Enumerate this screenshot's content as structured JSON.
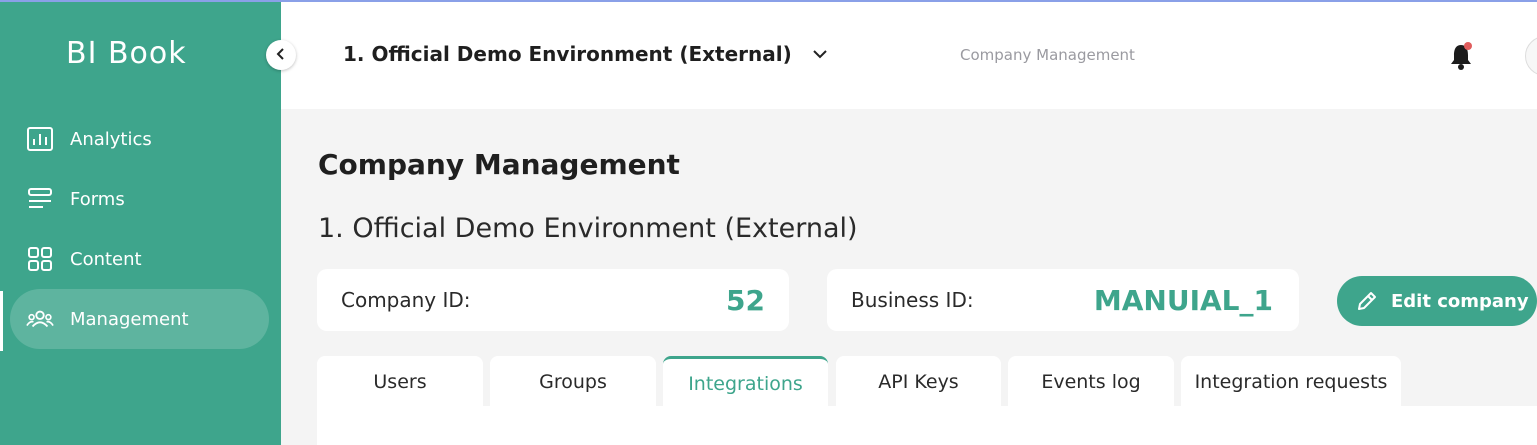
{
  "app": {
    "logo": "BI Book"
  },
  "sidebar": {
    "items": [
      {
        "label": "Analytics",
        "icon": "analytics-icon",
        "active": false
      },
      {
        "label": "Forms",
        "icon": "forms-icon",
        "active": false
      },
      {
        "label": "Content",
        "icon": "content-icon",
        "active": false
      },
      {
        "label": "Management",
        "icon": "users-icon",
        "active": true
      }
    ]
  },
  "header": {
    "environment": "1. Official Demo Environment (External)",
    "breadcrumb": "Company Management"
  },
  "main": {
    "title": "Company Management",
    "company_name": "1. Official Demo Environment (External)",
    "company_id_label": "Company ID:",
    "company_id_value": "52",
    "business_id_label": "Business ID:",
    "business_id_value": "MANUIAL_1",
    "edit_button": "Edit company",
    "tabs": [
      {
        "label": "Users",
        "active": false
      },
      {
        "label": "Groups",
        "active": false
      },
      {
        "label": "Integrations",
        "active": true
      },
      {
        "label": "API Keys",
        "active": false
      },
      {
        "label": "Events log",
        "active": false
      },
      {
        "label": "Integration requests",
        "active": false
      }
    ]
  },
  "colors": {
    "accent": "#3ea58c",
    "notification_dot": "#e05d5d"
  }
}
